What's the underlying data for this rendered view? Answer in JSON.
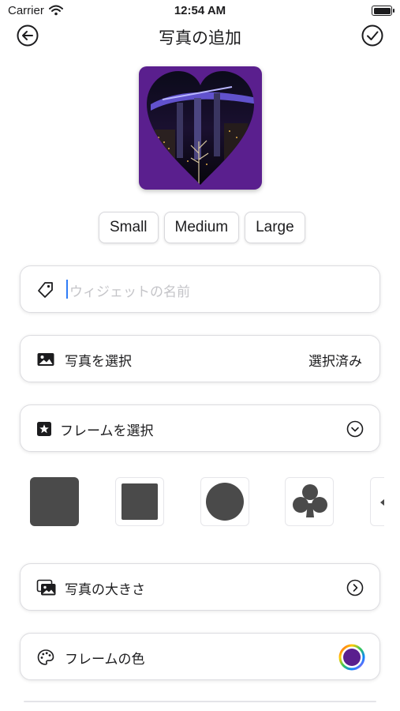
{
  "status_bar": {
    "carrier": "Carrier",
    "time": "12:54 AM"
  },
  "nav": {
    "title": "写真の追加",
    "back_icon": "back-arrow-circle-icon",
    "done_icon": "checkmark-circle-icon"
  },
  "preview": {
    "frame_shape": "heart",
    "background_color": "#5a1f8e"
  },
  "sizes": [
    "Small",
    "Medium",
    "Large"
  ],
  "widget_name": {
    "placeholder": "ウィジェットの名前",
    "value": "",
    "icon": "tag-icon"
  },
  "photo_select": {
    "label": "写真を選択",
    "value": "選択済み",
    "icon": "photo-icon"
  },
  "frame_select": {
    "label": "フレームを選択",
    "icon": "star-square-icon",
    "trailing_icon": "chevron-down-circle-icon"
  },
  "frames": [
    {
      "name": "rounded-square",
      "selected": true
    },
    {
      "name": "square",
      "selected": false
    },
    {
      "name": "circle",
      "selected": false
    },
    {
      "name": "club",
      "selected": false
    },
    {
      "name": "next",
      "selected": false
    }
  ],
  "photo_size": {
    "label": "写真の大きさ",
    "icon": "photos-stack-icon",
    "trailing_icon": "chevron-right-circle-icon"
  },
  "frame_color": {
    "label": "フレームの色",
    "icon": "palette-icon",
    "color": "#5a1f8e"
  },
  "colors": {
    "accent": "#2f7cf6",
    "frame_purple": "#5a1f8e",
    "dark": "#4a4a4a"
  }
}
